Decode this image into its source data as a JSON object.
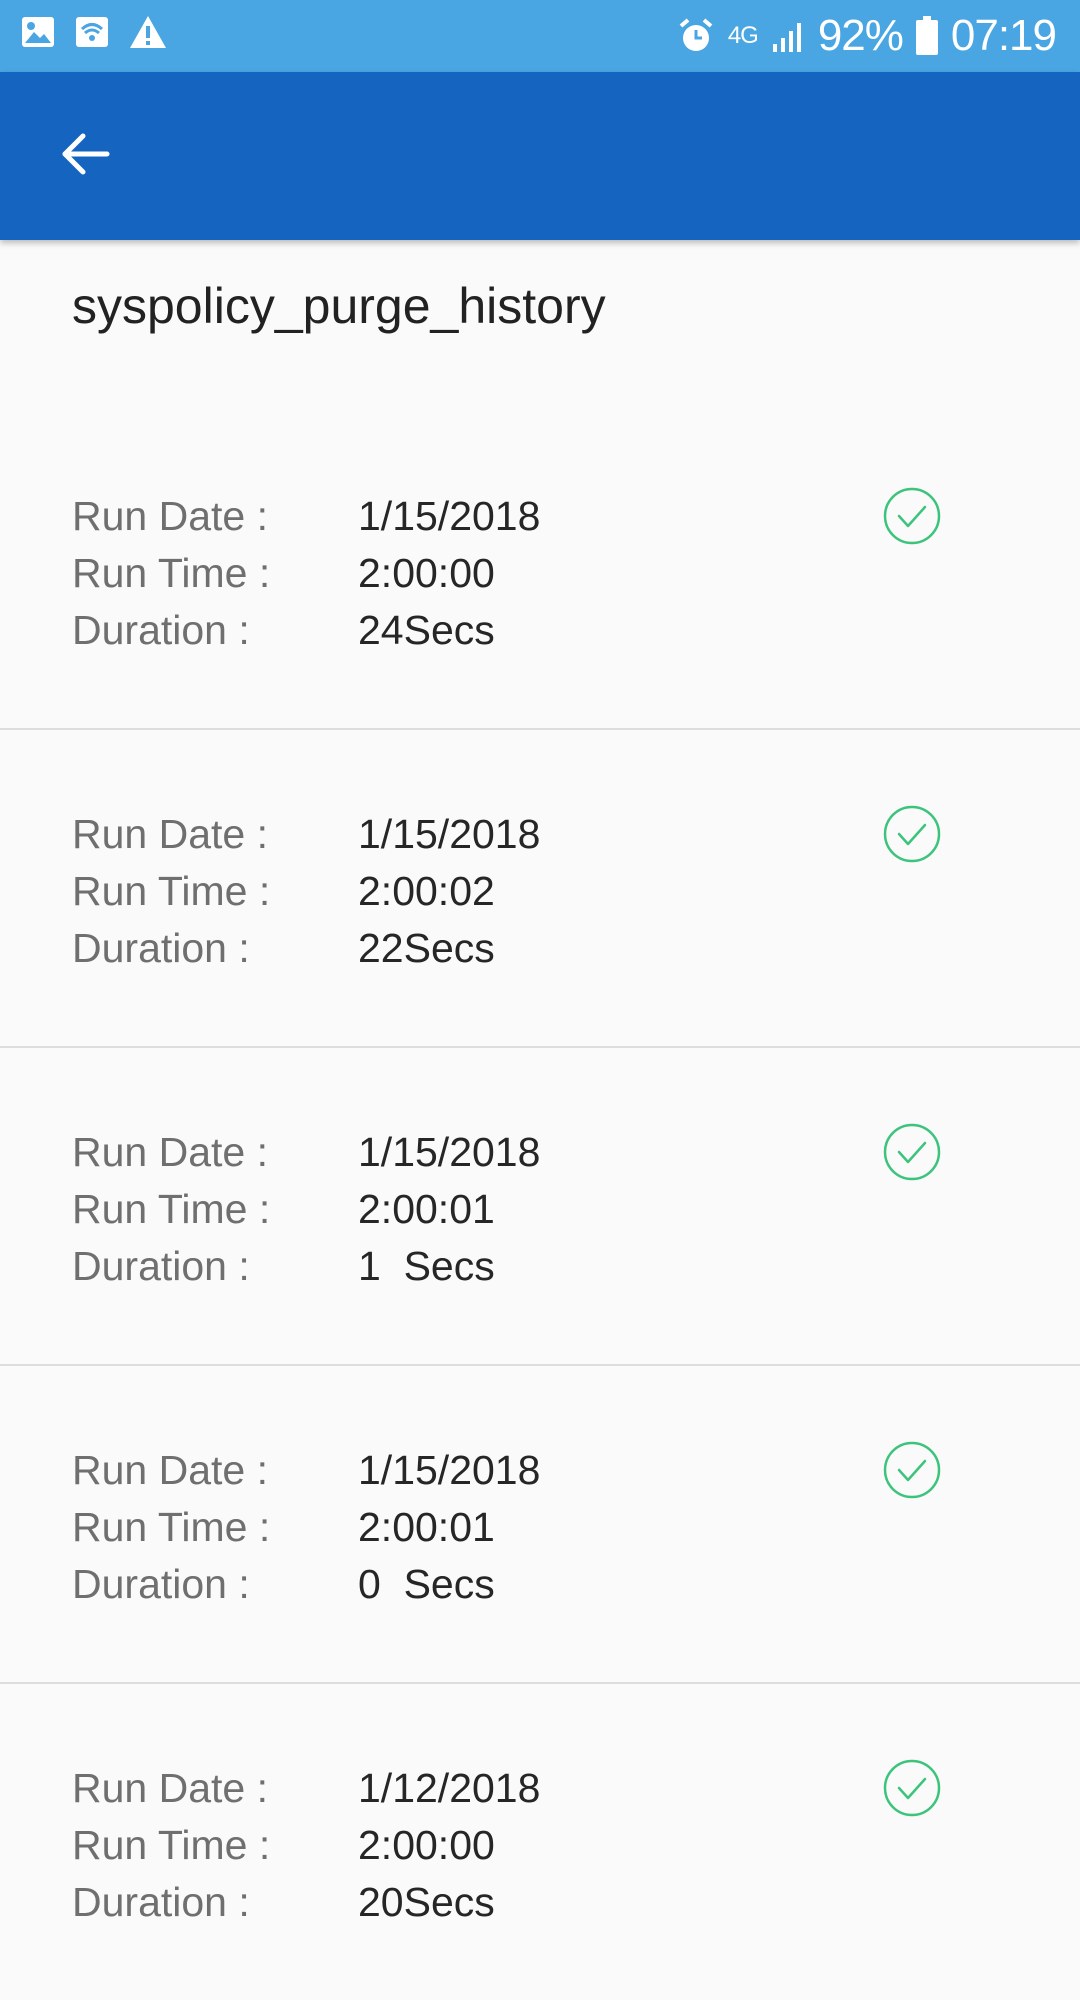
{
  "status_bar": {
    "left_icons": [
      "image-icon",
      "wifi-icon",
      "warning-icon"
    ],
    "alarm_icon": "alarm-icon",
    "network": "4G",
    "signal_icon": "signal-icon",
    "battery_percent": "92%",
    "battery_icon": "battery-icon",
    "time": "07:19"
  },
  "app_bar": {
    "back_icon": "back-arrow-icon",
    "color": "#1565c0"
  },
  "job": {
    "title": "syspolicy_purge_history"
  },
  "labels": {
    "run_date": "Run Date :",
    "run_time": "Run Time :",
    "duration": "Duration :"
  },
  "runs": [
    {
      "run_date": "1/15/2018",
      "run_time": "2:00:00",
      "duration": "24Secs",
      "status": "success",
      "status_icon": "check-circle-icon"
    },
    {
      "run_date": "1/15/2018",
      "run_time": "2:00:02",
      "duration": "22Secs",
      "status": "success",
      "status_icon": "check-circle-icon"
    },
    {
      "run_date": "1/15/2018",
      "run_time": "2:00:01",
      "duration": "1  Secs",
      "status": "success",
      "status_icon": "check-circle-icon"
    },
    {
      "run_date": "1/15/2018",
      "run_time": "2:00:01",
      "duration": "0  Secs",
      "status": "success",
      "status_icon": "check-circle-icon"
    },
    {
      "run_date": "1/12/2018",
      "run_time": "2:00:00",
      "duration": "20Secs",
      "status": "success",
      "status_icon": "check-circle-icon"
    }
  ],
  "colors": {
    "status_bar": "#4aa6e3",
    "app_bar": "#1565c0",
    "success": "#3cc47c"
  }
}
